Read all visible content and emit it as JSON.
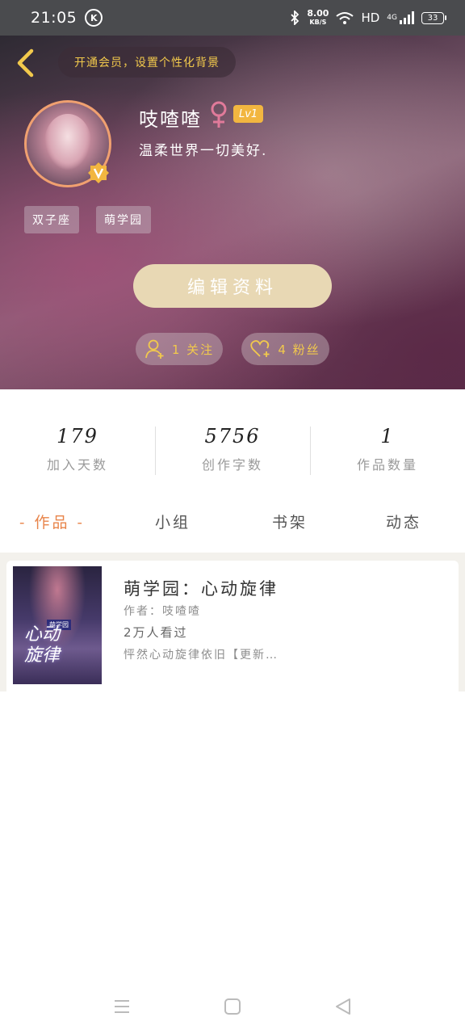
{
  "status_bar": {
    "time": "21:05",
    "k_icon": "K",
    "net_speed": "8.00",
    "net_unit": "KB/S",
    "hd": "HD",
    "network": "4G",
    "battery": "33"
  },
  "header": {
    "vip_text": "开通会员，设置个性化背景",
    "username": "吱喳喳",
    "level": "Lv1",
    "bio": "温柔世界一切美好.",
    "tags": [
      "双子座",
      "萌学园"
    ],
    "edit_button": "编辑资料",
    "follow_label": "1 关注",
    "fans_label": "4 粉丝",
    "accent_color": "#f2c94c"
  },
  "stats": [
    {
      "value": "179",
      "label": "加入天数"
    },
    {
      "value": "5756",
      "label": "创作字数"
    },
    {
      "value": "1",
      "label": "作品数量"
    }
  ],
  "tabs": [
    "- 作品 -",
    "小组",
    "书架",
    "动态"
  ],
  "book": {
    "title": "萌学园：心动旋律",
    "author": "作者：吱喳喳",
    "views": "2万人看过",
    "desc": "怦然心动旋律依旧【更新…",
    "cover_title_line1": "心动",
    "cover_title_line2": "旋律",
    "cover_brand": "萌学园"
  },
  "nav": {
    "menu_icon": "menu-icon",
    "home_icon": "home-square-icon",
    "back_icon": "back-triangle-icon"
  }
}
